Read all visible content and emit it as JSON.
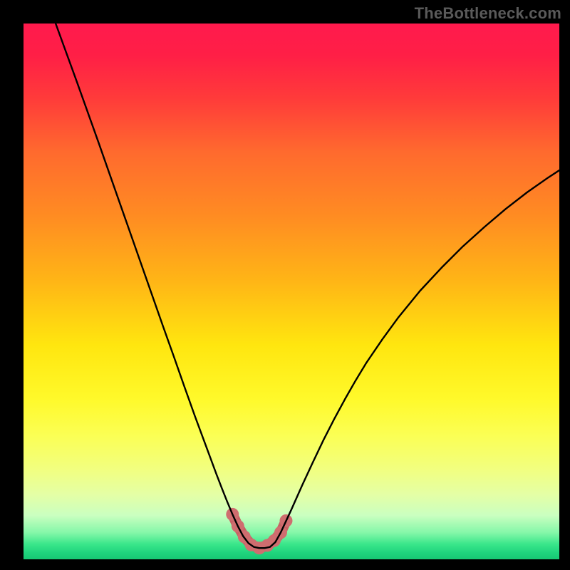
{
  "watermark": "TheBottleneck.com",
  "colors": {
    "frame": "#000000",
    "gradient_stops": [
      {
        "offset": 0.0,
        "color": "#ff1a4d"
      },
      {
        "offset": 0.06,
        "color": "#ff1f46"
      },
      {
        "offset": 0.14,
        "color": "#ff3b3a"
      },
      {
        "offset": 0.24,
        "color": "#ff6a2e"
      },
      {
        "offset": 0.36,
        "color": "#ff8c22"
      },
      {
        "offset": 0.48,
        "color": "#ffb516"
      },
      {
        "offset": 0.6,
        "color": "#ffe60f"
      },
      {
        "offset": 0.7,
        "color": "#fff92a"
      },
      {
        "offset": 0.77,
        "color": "#fbff55"
      },
      {
        "offset": 0.83,
        "color": "#f2ff7e"
      },
      {
        "offset": 0.88,
        "color": "#e4ffa6"
      },
      {
        "offset": 0.918,
        "color": "#caffc0"
      },
      {
        "offset": 0.95,
        "color": "#85f7a9"
      },
      {
        "offset": 0.972,
        "color": "#39e68a"
      },
      {
        "offset": 0.988,
        "color": "#1fd47d"
      },
      {
        "offset": 1.0,
        "color": "#17c873"
      }
    ],
    "curve": "#000000",
    "marker_fill": "#cf6d6f",
    "marker_stroke": "#c66264"
  },
  "chart_data": {
    "type": "line",
    "title": "",
    "xlabel": "",
    "ylabel": "",
    "xlim": [
      0,
      100
    ],
    "ylim": [
      0,
      100
    ],
    "grid": false,
    "series": [
      {
        "name": "curve",
        "x": [
          6,
          8,
          10,
          12,
          14,
          16,
          18,
          20,
          22,
          24,
          26,
          28,
          30,
          32,
          34,
          36,
          37,
          38,
          39,
          40,
          41,
          42,
          43,
          44,
          45,
          46,
          47,
          48,
          50,
          52,
          54,
          56,
          58,
          60,
          62,
          64,
          67,
          70,
          74,
          78,
          82,
          86,
          90,
          94,
          98,
          100
        ],
        "y": [
          100,
          94.5,
          89.0,
          83.4,
          77.8,
          72.1,
          66.4,
          60.7,
          55.0,
          49.3,
          43.6,
          38.0,
          32.3,
          26.7,
          21.3,
          15.9,
          13.3,
          10.8,
          8.4,
          6.2,
          4.3,
          3.0,
          2.3,
          2.1,
          2.1,
          2.3,
          3.2,
          5.0,
          9.3,
          13.8,
          18.1,
          22.3,
          26.2,
          29.9,
          33.4,
          36.7,
          41.1,
          45.2,
          50.1,
          54.4,
          58.4,
          62.0,
          65.4,
          68.5,
          71.3,
          72.6
        ]
      }
    ],
    "markers": {
      "name": "bottom-segment",
      "x": [
        39.0,
        40.0,
        41.2,
        42.5,
        44.0,
        45.5,
        46.8,
        48.0,
        49.0
      ],
      "y": [
        8.4,
        6.2,
        4.2,
        2.7,
        2.1,
        2.6,
        3.5,
        5.0,
        7.2
      ]
    }
  }
}
